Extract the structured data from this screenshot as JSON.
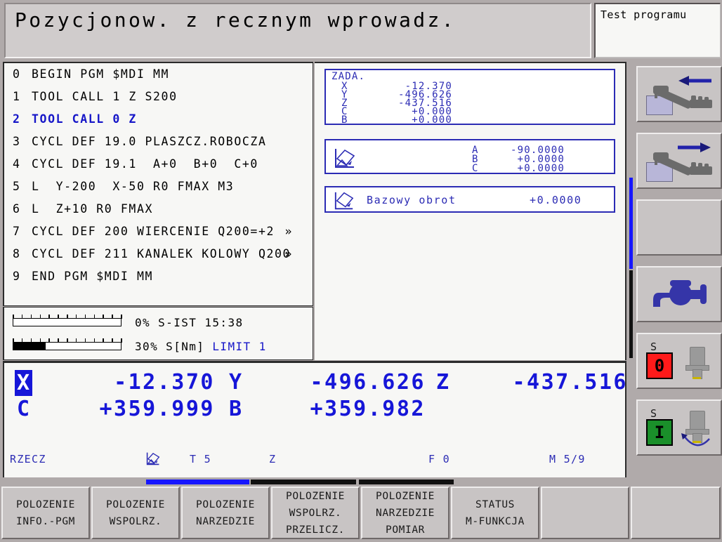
{
  "header": {
    "mode_title": "Pozycjonow. z recznym wprowadz.",
    "status_title": "Test programu"
  },
  "program": {
    "lines": [
      {
        "num": "0",
        "text": "BEGIN PGM $MDI MM",
        "more": "",
        "active": false
      },
      {
        "num": "1",
        "text": "TOOL CALL 1 Z S200",
        "more": "",
        "active": false
      },
      {
        "num": "2",
        "text": "TOOL CALL 0 Z",
        "more": "",
        "active": true
      },
      {
        "num": "3",
        "text": "CYCL DEF 19.0 PLASZCZ.ROBOCZA",
        "more": "",
        "active": false
      },
      {
        "num": "4",
        "text": "CYCL DEF 19.1  A+0  B+0  C+0",
        "more": "",
        "active": false
      },
      {
        "num": "5",
        "text": "L  Y-200  X-50 R0 FMAX M3",
        "more": "",
        "active": false
      },
      {
        "num": "6",
        "text": "L  Z+10 R0 FMAX",
        "more": "",
        "active": false
      },
      {
        "num": "7",
        "text": "CYCL DEF 200 WIERCENIE Q200=+2",
        "more": "»",
        "active": false
      },
      {
        "num": "8",
        "text": "CYCL DEF 211 KANALEK KOLOWY Q200",
        "more": "»",
        "active": false
      },
      {
        "num": "9",
        "text": "END PGM $MDI MM",
        "more": "",
        "active": false
      }
    ]
  },
  "status_bars": [
    {
      "percent": 0,
      "fill_ratio": 0.0,
      "label": "0% S-IST 15:38",
      "label_percent": "0%",
      "label_name": "S-IST",
      "label_extra": "15:38",
      "limit": ""
    },
    {
      "percent": 30,
      "fill_ratio": 0.3,
      "label": "30% S[Nm] ",
      "label_percent": "30%",
      "label_name": "S[Nm]",
      "label_extra": "",
      "limit": "LIMIT 1"
    }
  ],
  "nominal": {
    "title": "ZADA.",
    "axes": [
      {
        "name": "X",
        "value": "-12.370"
      },
      {
        "name": "Y",
        "value": "-496.626"
      },
      {
        "name": "Z",
        "value": "-437.516"
      },
      {
        "name": "C",
        "value": "+0.000"
      },
      {
        "name": "B",
        "value": "+0.000"
      }
    ]
  },
  "tilt": {
    "icon": "tilted-plane-icon",
    "axes": [
      {
        "name": "A",
        "value": "-90.0000"
      },
      {
        "name": "B",
        "value": "+0.0000"
      },
      {
        "name": "C",
        "value": "+0.0000"
      }
    ]
  },
  "basic_rotation": {
    "icon": "tilted-plane-icon",
    "label": "Bazowy obrot",
    "value": "+0.0000"
  },
  "position_display": {
    "rows": [
      [
        {
          "axis": "X",
          "value": "-12.370",
          "highlighted": true
        },
        {
          "axis": "Y",
          "value": "-496.626",
          "highlighted": false
        },
        {
          "axis": "Z",
          "value": "-437.516",
          "highlighted": false
        }
      ],
      [
        {
          "axis": "C",
          "value": "+359.999",
          "highlighted": false
        },
        {
          "axis": "B",
          "value": "+359.982",
          "highlighted": false
        }
      ]
    ],
    "status_line": {
      "mode": "RZECZ",
      "tilt_icon": "tilted-plane-icon",
      "tool": "T 5",
      "tool_axis": "Z",
      "feed": "F 0",
      "mfunc": "M 5/9"
    }
  },
  "vertical_keys": [
    {
      "name": "machine-arrow-left",
      "icon": "machine-left-icon",
      "label": ""
    },
    {
      "name": "machine-arrow-right",
      "icon": "machine-right-icon",
      "label": ""
    },
    {
      "name": "blank-key-1",
      "icon": "",
      "label": ""
    },
    {
      "name": "coolant",
      "icon": "tap-icon",
      "label": ""
    },
    {
      "name": "spindle-stop",
      "icon": "spindle-icon",
      "label": "S",
      "state": "0",
      "state_color": "#ff1a1a"
    },
    {
      "name": "spindle-start",
      "icon": "spindle-rotate-icon",
      "label": "S",
      "state": "I",
      "state_color": "#1a8f2a"
    }
  ],
  "softkeys": [
    {
      "line1": "POLOZENIE",
      "line2": "INFO.-PGM"
    },
    {
      "line1": "POLOZENIE",
      "line2": "WSPOLRZ."
    },
    {
      "line1": "POLOZENIE",
      "line2": "NARZEDZIE"
    },
    {
      "line1": "POLOZENIE",
      "line2": "WSPOLRZ.",
      "line3": "PRZELICZ."
    },
    {
      "line1": "POLOZENIE",
      "line2": "NARZEDZIE",
      "line3": "POMIAR"
    },
    {
      "line1": "STATUS",
      "line2": "M-FUNKCJA"
    },
    {
      "line1": "",
      "line2": ""
    },
    {
      "line1": "",
      "line2": ""
    }
  ],
  "colors": {
    "accent_blue": "#1616d8",
    "text_blue": "#2b2bb4",
    "panel_bg": "#f7f7f5",
    "chrome": "#b0aaaa",
    "key_face": "#c8c4c4"
  }
}
